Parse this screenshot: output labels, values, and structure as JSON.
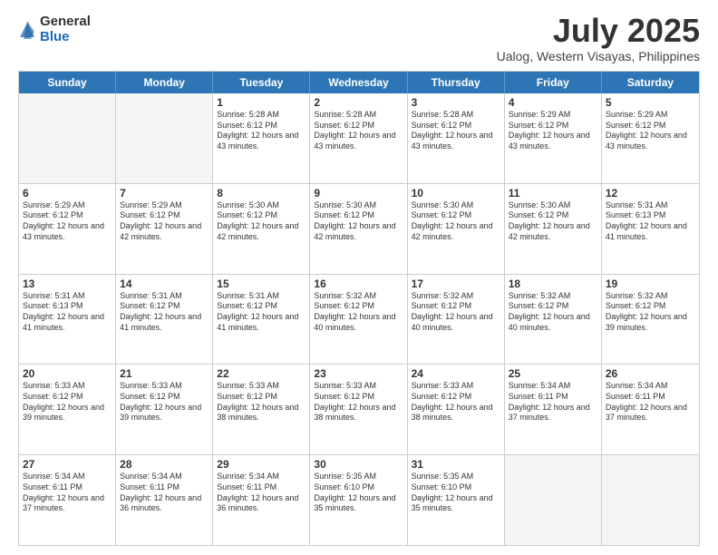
{
  "logo": {
    "general": "General",
    "blue": "Blue"
  },
  "title": "July 2025",
  "subtitle": "Ualog, Western Visayas, Philippines",
  "days_of_week": [
    "Sunday",
    "Monday",
    "Tuesday",
    "Wednesday",
    "Thursday",
    "Friday",
    "Saturday"
  ],
  "weeks": [
    [
      {
        "day": "",
        "empty": true
      },
      {
        "day": "",
        "empty": true
      },
      {
        "day": "1",
        "sunrise": "Sunrise: 5:28 AM",
        "sunset": "Sunset: 6:12 PM",
        "daylight": "Daylight: 12 hours and 43 minutes."
      },
      {
        "day": "2",
        "sunrise": "Sunrise: 5:28 AM",
        "sunset": "Sunset: 6:12 PM",
        "daylight": "Daylight: 12 hours and 43 minutes."
      },
      {
        "day": "3",
        "sunrise": "Sunrise: 5:28 AM",
        "sunset": "Sunset: 6:12 PM",
        "daylight": "Daylight: 12 hours and 43 minutes."
      },
      {
        "day": "4",
        "sunrise": "Sunrise: 5:29 AM",
        "sunset": "Sunset: 6:12 PM",
        "daylight": "Daylight: 12 hours and 43 minutes."
      },
      {
        "day": "5",
        "sunrise": "Sunrise: 5:29 AM",
        "sunset": "Sunset: 6:12 PM",
        "daylight": "Daylight: 12 hours and 43 minutes."
      }
    ],
    [
      {
        "day": "6",
        "sunrise": "Sunrise: 5:29 AM",
        "sunset": "Sunset: 6:12 PM",
        "daylight": "Daylight: 12 hours and 43 minutes."
      },
      {
        "day": "7",
        "sunrise": "Sunrise: 5:29 AM",
        "sunset": "Sunset: 6:12 PM",
        "daylight": "Daylight: 12 hours and 42 minutes."
      },
      {
        "day": "8",
        "sunrise": "Sunrise: 5:30 AM",
        "sunset": "Sunset: 6:12 PM",
        "daylight": "Daylight: 12 hours and 42 minutes."
      },
      {
        "day": "9",
        "sunrise": "Sunrise: 5:30 AM",
        "sunset": "Sunset: 6:12 PM",
        "daylight": "Daylight: 12 hours and 42 minutes."
      },
      {
        "day": "10",
        "sunrise": "Sunrise: 5:30 AM",
        "sunset": "Sunset: 6:12 PM",
        "daylight": "Daylight: 12 hours and 42 minutes."
      },
      {
        "day": "11",
        "sunrise": "Sunrise: 5:30 AM",
        "sunset": "Sunset: 6:12 PM",
        "daylight": "Daylight: 12 hours and 42 minutes."
      },
      {
        "day": "12",
        "sunrise": "Sunrise: 5:31 AM",
        "sunset": "Sunset: 6:13 PM",
        "daylight": "Daylight: 12 hours and 41 minutes."
      }
    ],
    [
      {
        "day": "13",
        "sunrise": "Sunrise: 5:31 AM",
        "sunset": "Sunset: 6:13 PM",
        "daylight": "Daylight: 12 hours and 41 minutes."
      },
      {
        "day": "14",
        "sunrise": "Sunrise: 5:31 AM",
        "sunset": "Sunset: 6:12 PM",
        "daylight": "Daylight: 12 hours and 41 minutes."
      },
      {
        "day": "15",
        "sunrise": "Sunrise: 5:31 AM",
        "sunset": "Sunset: 6:12 PM",
        "daylight": "Daylight: 12 hours and 41 minutes."
      },
      {
        "day": "16",
        "sunrise": "Sunrise: 5:32 AM",
        "sunset": "Sunset: 6:12 PM",
        "daylight": "Daylight: 12 hours and 40 minutes."
      },
      {
        "day": "17",
        "sunrise": "Sunrise: 5:32 AM",
        "sunset": "Sunset: 6:12 PM",
        "daylight": "Daylight: 12 hours and 40 minutes."
      },
      {
        "day": "18",
        "sunrise": "Sunrise: 5:32 AM",
        "sunset": "Sunset: 6:12 PM",
        "daylight": "Daylight: 12 hours and 40 minutes."
      },
      {
        "day": "19",
        "sunrise": "Sunrise: 5:32 AM",
        "sunset": "Sunset: 6:12 PM",
        "daylight": "Daylight: 12 hours and 39 minutes."
      }
    ],
    [
      {
        "day": "20",
        "sunrise": "Sunrise: 5:33 AM",
        "sunset": "Sunset: 6:12 PM",
        "daylight": "Daylight: 12 hours and 39 minutes."
      },
      {
        "day": "21",
        "sunrise": "Sunrise: 5:33 AM",
        "sunset": "Sunset: 6:12 PM",
        "daylight": "Daylight: 12 hours and 39 minutes."
      },
      {
        "day": "22",
        "sunrise": "Sunrise: 5:33 AM",
        "sunset": "Sunset: 6:12 PM",
        "daylight": "Daylight: 12 hours and 38 minutes."
      },
      {
        "day": "23",
        "sunrise": "Sunrise: 5:33 AM",
        "sunset": "Sunset: 6:12 PM",
        "daylight": "Daylight: 12 hours and 38 minutes."
      },
      {
        "day": "24",
        "sunrise": "Sunrise: 5:33 AM",
        "sunset": "Sunset: 6:12 PM",
        "daylight": "Daylight: 12 hours and 38 minutes."
      },
      {
        "day": "25",
        "sunrise": "Sunrise: 5:34 AM",
        "sunset": "Sunset: 6:11 PM",
        "daylight": "Daylight: 12 hours and 37 minutes."
      },
      {
        "day": "26",
        "sunrise": "Sunrise: 5:34 AM",
        "sunset": "Sunset: 6:11 PM",
        "daylight": "Daylight: 12 hours and 37 minutes."
      }
    ],
    [
      {
        "day": "27",
        "sunrise": "Sunrise: 5:34 AM",
        "sunset": "Sunset: 6:11 PM",
        "daylight": "Daylight: 12 hours and 37 minutes."
      },
      {
        "day": "28",
        "sunrise": "Sunrise: 5:34 AM",
        "sunset": "Sunset: 6:11 PM",
        "daylight": "Daylight: 12 hours and 36 minutes."
      },
      {
        "day": "29",
        "sunrise": "Sunrise: 5:34 AM",
        "sunset": "Sunset: 6:11 PM",
        "daylight": "Daylight: 12 hours and 36 minutes."
      },
      {
        "day": "30",
        "sunrise": "Sunrise: 5:35 AM",
        "sunset": "Sunset: 6:10 PM",
        "daylight": "Daylight: 12 hours and 35 minutes."
      },
      {
        "day": "31",
        "sunrise": "Sunrise: 5:35 AM",
        "sunset": "Sunset: 6:10 PM",
        "daylight": "Daylight: 12 hours and 35 minutes."
      },
      {
        "day": "",
        "empty": true
      },
      {
        "day": "",
        "empty": true
      }
    ]
  ]
}
